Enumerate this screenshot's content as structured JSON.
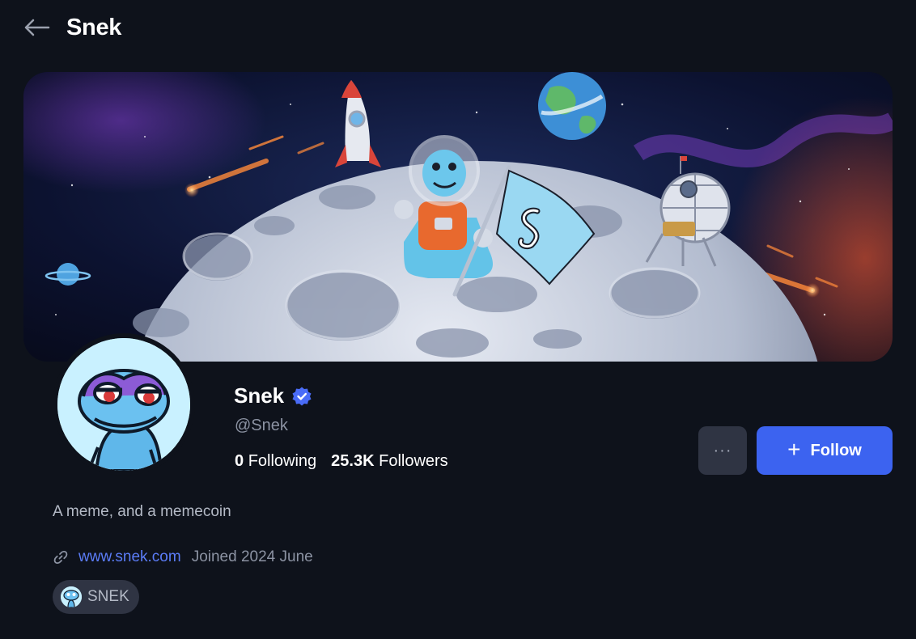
{
  "header": {
    "title": "Snek",
    "back_icon": "arrow-left-icon"
  },
  "banner": {
    "scene": "snek astronaut on the moon"
  },
  "profile": {
    "display_name": "Snek",
    "verified": true,
    "handle": "@Snek",
    "following_count": "0",
    "following_label": "Following",
    "followers_count": "25.3K",
    "followers_label": "Followers",
    "bio": "A meme, and a memecoin",
    "website": "www.snek.com",
    "joined": "Joined 2024 June",
    "token": "SNEK"
  },
  "actions": {
    "more_label": "···",
    "follow_label": "Follow",
    "follow_icon": "plus-icon"
  },
  "colors": {
    "background": "#0e121b",
    "accent": "#3c63f0",
    "link": "#5b7cf7",
    "chip": "#2f3443",
    "verified": "#4a6cf7"
  }
}
